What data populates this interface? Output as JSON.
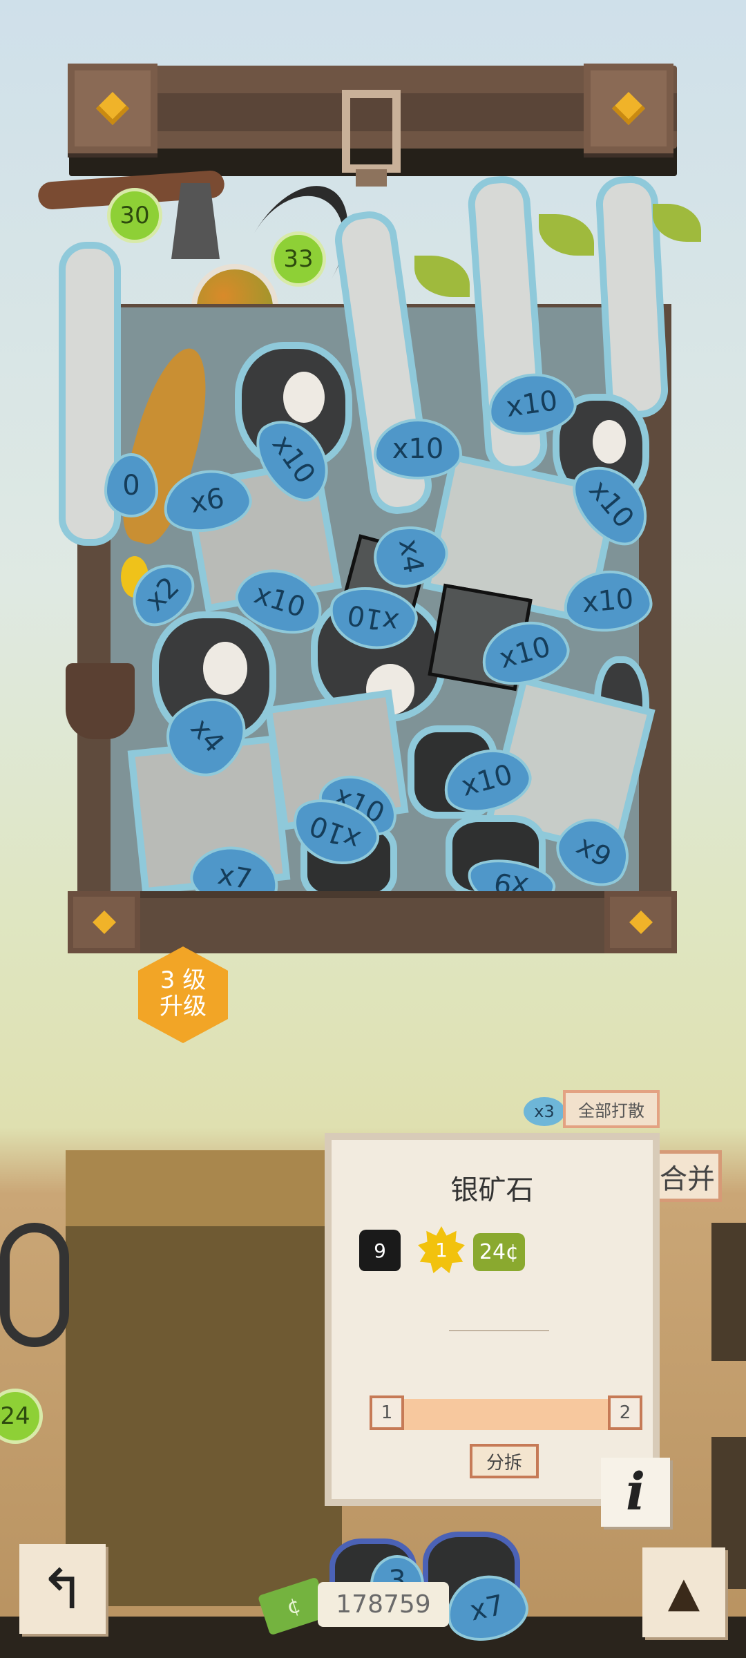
{
  "inventory": {
    "item_count_tags": [
      "x10",
      "x6",
      "x10",
      "x10",
      "x4",
      "x10",
      "x2",
      "x10",
      "x10",
      "x10",
      "x10",
      "x4",
      "x10",
      "x10",
      "x10",
      "x7",
      "x9"
    ],
    "partial_tag": "0",
    "timers": [
      "30",
      "33"
    ],
    "side_timer": "24"
  },
  "level_badge": {
    "line1": "3 级",
    "line2": "升级"
  },
  "scatter": {
    "count": "x3",
    "label": "全部打散"
  },
  "merge_label": "合并",
  "item_card": {
    "name": "银矿石",
    "weight": "9",
    "star_value": "1",
    "price": "24¢",
    "split_min": "1",
    "split_max": "2",
    "split_label": "分拆",
    "info_label": "i"
  },
  "bottom": {
    "money": "178759",
    "money_icon": "¢",
    "back_icon": "↰",
    "stack_tags": [
      "3",
      "x7"
    ]
  }
}
